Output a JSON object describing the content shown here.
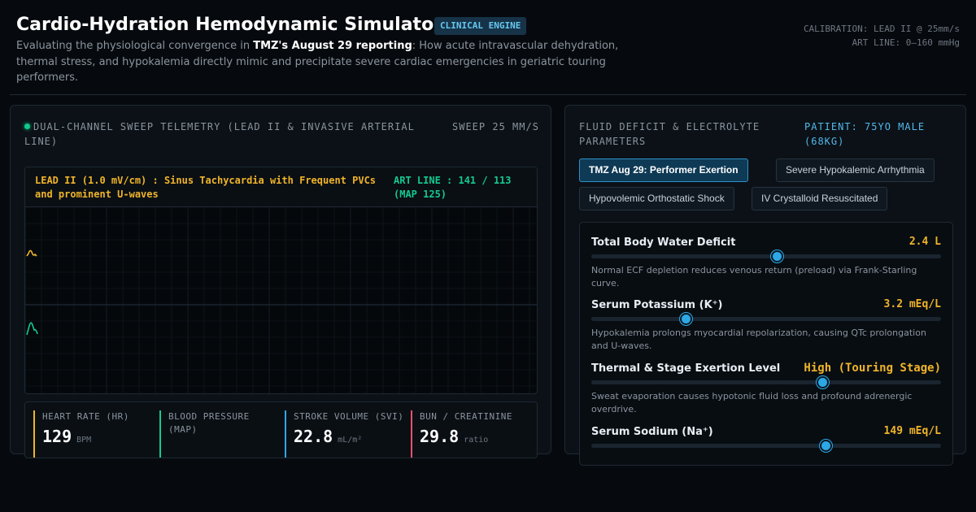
{
  "header": {
    "title": "Cardio-Hydration Hemodynamic Simulator",
    "badge": "CLINICAL ENGINE",
    "subtitle_prefix": "Evaluating the physiological convergence in ",
    "subtitle_bold": "TMZ's August 29 reporting",
    "subtitle_suffix": ": How acute intravascular dehydration, thermal stress, and hypokalemia directly mimic and precipitate severe cardiac emergencies in geriatric touring performers.",
    "calibration_line1": "CALIBRATION: LEAD II @ 25mm/s",
    "calibration_line2": "ART LINE: 0–160 mmHg"
  },
  "telemetry": {
    "title": "DUAL-CHANNEL SWEEP TELEMETRY (LEAD II & INVASIVE ARTERIAL LINE)",
    "sweep": "SWEEP 25 MM/S",
    "lead_label": "LEAD II (1.0 mV/cm) : Sinus Tachycardia with Frequent PVCs and prominent U-waves",
    "art_label": "ART LINE : 141 / 113 (MAP 125)",
    "colors": {
      "ecg": "#f0b429",
      "art": "#14c98f",
      "grid": "#131c24"
    }
  },
  "vitals": [
    {
      "label": "HEART RATE (HR)",
      "value": "129",
      "unit": "BPM",
      "color": "#f0b429"
    },
    {
      "label": "BLOOD PRESSURE (MAP)",
      "value": "",
      "unit": "",
      "color": "#14c98f"
    },
    {
      "label": "STROKE VOLUME (SVI)",
      "value": "22.8",
      "unit": "mL/m²",
      "color": "#2da8e6"
    },
    {
      "label": "BUN / CREATININE",
      "value": "29.8",
      "unit": "ratio",
      "color": "#f0506e"
    }
  ],
  "parameters_panel": {
    "title": "FLUID DEFICIT & ELECTROLYTE PARAMETERS",
    "patient": "PATIENT: 75YO MALE (68KG)",
    "scenarios": [
      {
        "label": "TMZ Aug 29: Performer Exertion",
        "active": true
      },
      {
        "label": "Severe Hypokalemic Arrhythmia",
        "active": false
      },
      {
        "label": "Hypovolemic Orthostatic Shock",
        "active": false
      },
      {
        "label": "IV Crystalloid Resuscitated",
        "active": false
      }
    ],
    "params": [
      {
        "name": "Total Body Water Deficit",
        "value": "2.4 L",
        "level": 0.53,
        "desc": "Normal ECF depletion reduces venous return (preload) via Frank-Starling curve."
      },
      {
        "name": "Serum Potassium (K⁺)",
        "value": "3.2 mEq/L",
        "level": 0.27,
        "desc": "Hypokalemia prolongs myocardial repolarization, causing QTc prolongation and U-waves."
      },
      {
        "name": "Thermal & Stage Exertion Level",
        "value": "High (Touring Stage)",
        "level": 0.66,
        "desc": "Sweat evaporation causes hypotonic fluid loss and profound adrenergic overdrive."
      },
      {
        "name": "Serum Sodium (Na⁺)",
        "value": "149 mEq/L",
        "level": 0.67,
        "desc": ""
      }
    ]
  }
}
